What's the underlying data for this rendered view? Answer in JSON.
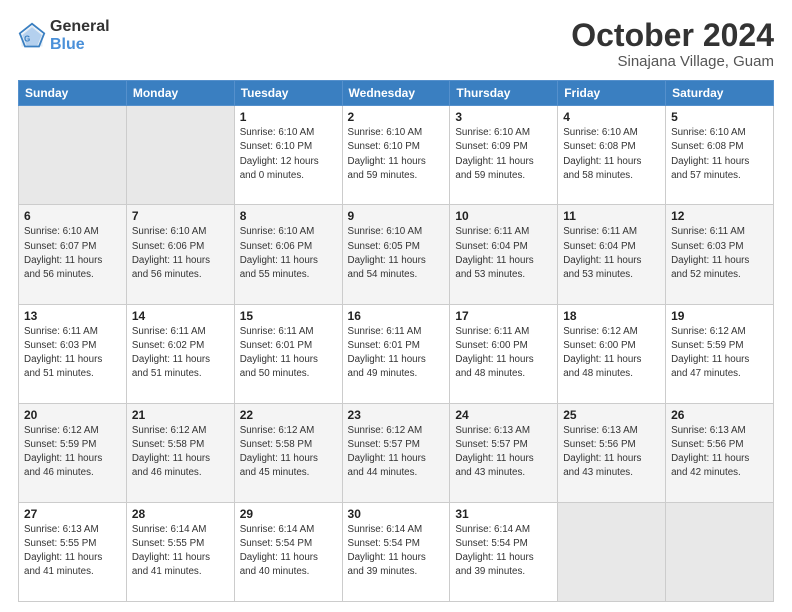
{
  "header": {
    "logo_general": "General",
    "logo_blue": "Blue",
    "title": "October 2024",
    "subtitle": "Sinajana Village, Guam"
  },
  "weekdays": [
    "Sunday",
    "Monday",
    "Tuesday",
    "Wednesday",
    "Thursday",
    "Friday",
    "Saturday"
  ],
  "weeks": [
    [
      {
        "day": "",
        "info": ""
      },
      {
        "day": "",
        "info": ""
      },
      {
        "day": "1",
        "info": "Sunrise: 6:10 AM\nSunset: 6:10 PM\nDaylight: 12 hours\nand 0 minutes."
      },
      {
        "day": "2",
        "info": "Sunrise: 6:10 AM\nSunset: 6:10 PM\nDaylight: 11 hours\nand 59 minutes."
      },
      {
        "day": "3",
        "info": "Sunrise: 6:10 AM\nSunset: 6:09 PM\nDaylight: 11 hours\nand 59 minutes."
      },
      {
        "day": "4",
        "info": "Sunrise: 6:10 AM\nSunset: 6:08 PM\nDaylight: 11 hours\nand 58 minutes."
      },
      {
        "day": "5",
        "info": "Sunrise: 6:10 AM\nSunset: 6:08 PM\nDaylight: 11 hours\nand 57 minutes."
      }
    ],
    [
      {
        "day": "6",
        "info": "Sunrise: 6:10 AM\nSunset: 6:07 PM\nDaylight: 11 hours\nand 56 minutes."
      },
      {
        "day": "7",
        "info": "Sunrise: 6:10 AM\nSunset: 6:06 PM\nDaylight: 11 hours\nand 56 minutes."
      },
      {
        "day": "8",
        "info": "Sunrise: 6:10 AM\nSunset: 6:06 PM\nDaylight: 11 hours\nand 55 minutes."
      },
      {
        "day": "9",
        "info": "Sunrise: 6:10 AM\nSunset: 6:05 PM\nDaylight: 11 hours\nand 54 minutes."
      },
      {
        "day": "10",
        "info": "Sunrise: 6:11 AM\nSunset: 6:04 PM\nDaylight: 11 hours\nand 53 minutes."
      },
      {
        "day": "11",
        "info": "Sunrise: 6:11 AM\nSunset: 6:04 PM\nDaylight: 11 hours\nand 53 minutes."
      },
      {
        "day": "12",
        "info": "Sunrise: 6:11 AM\nSunset: 6:03 PM\nDaylight: 11 hours\nand 52 minutes."
      }
    ],
    [
      {
        "day": "13",
        "info": "Sunrise: 6:11 AM\nSunset: 6:03 PM\nDaylight: 11 hours\nand 51 minutes."
      },
      {
        "day": "14",
        "info": "Sunrise: 6:11 AM\nSunset: 6:02 PM\nDaylight: 11 hours\nand 51 minutes."
      },
      {
        "day": "15",
        "info": "Sunrise: 6:11 AM\nSunset: 6:01 PM\nDaylight: 11 hours\nand 50 minutes."
      },
      {
        "day": "16",
        "info": "Sunrise: 6:11 AM\nSunset: 6:01 PM\nDaylight: 11 hours\nand 49 minutes."
      },
      {
        "day": "17",
        "info": "Sunrise: 6:11 AM\nSunset: 6:00 PM\nDaylight: 11 hours\nand 48 minutes."
      },
      {
        "day": "18",
        "info": "Sunrise: 6:12 AM\nSunset: 6:00 PM\nDaylight: 11 hours\nand 48 minutes."
      },
      {
        "day": "19",
        "info": "Sunrise: 6:12 AM\nSunset: 5:59 PM\nDaylight: 11 hours\nand 47 minutes."
      }
    ],
    [
      {
        "day": "20",
        "info": "Sunrise: 6:12 AM\nSunset: 5:59 PM\nDaylight: 11 hours\nand 46 minutes."
      },
      {
        "day": "21",
        "info": "Sunrise: 6:12 AM\nSunset: 5:58 PM\nDaylight: 11 hours\nand 46 minutes."
      },
      {
        "day": "22",
        "info": "Sunrise: 6:12 AM\nSunset: 5:58 PM\nDaylight: 11 hours\nand 45 minutes."
      },
      {
        "day": "23",
        "info": "Sunrise: 6:12 AM\nSunset: 5:57 PM\nDaylight: 11 hours\nand 44 minutes."
      },
      {
        "day": "24",
        "info": "Sunrise: 6:13 AM\nSunset: 5:57 PM\nDaylight: 11 hours\nand 43 minutes."
      },
      {
        "day": "25",
        "info": "Sunrise: 6:13 AM\nSunset: 5:56 PM\nDaylight: 11 hours\nand 43 minutes."
      },
      {
        "day": "26",
        "info": "Sunrise: 6:13 AM\nSunset: 5:56 PM\nDaylight: 11 hours\nand 42 minutes."
      }
    ],
    [
      {
        "day": "27",
        "info": "Sunrise: 6:13 AM\nSunset: 5:55 PM\nDaylight: 11 hours\nand 41 minutes."
      },
      {
        "day": "28",
        "info": "Sunrise: 6:14 AM\nSunset: 5:55 PM\nDaylight: 11 hours\nand 41 minutes."
      },
      {
        "day": "29",
        "info": "Sunrise: 6:14 AM\nSunset: 5:54 PM\nDaylight: 11 hours\nand 40 minutes."
      },
      {
        "day": "30",
        "info": "Sunrise: 6:14 AM\nSunset: 5:54 PM\nDaylight: 11 hours\nand 39 minutes."
      },
      {
        "day": "31",
        "info": "Sunrise: 6:14 AM\nSunset: 5:54 PM\nDaylight: 11 hours\nand 39 minutes."
      },
      {
        "day": "",
        "info": ""
      },
      {
        "day": "",
        "info": ""
      }
    ]
  ]
}
